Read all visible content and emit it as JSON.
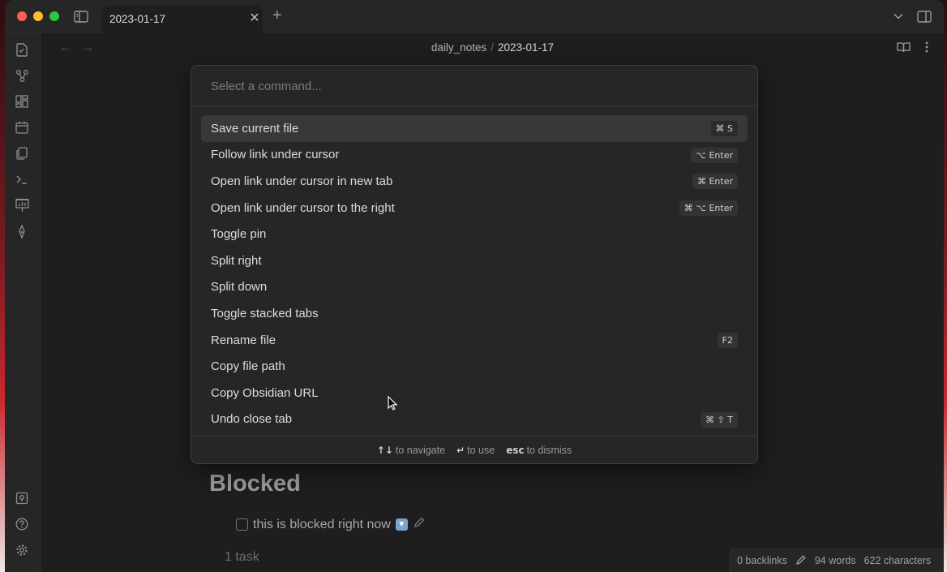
{
  "tab": {
    "title": "2023-01-17",
    "close": "✕",
    "add": "+"
  },
  "breadcrumb": {
    "folder": "daily_notes",
    "separator": "/",
    "file": "2023-01-17"
  },
  "palette": {
    "placeholder": "Select a command...",
    "commands": [
      {
        "label": "Save current file",
        "shortcut": "⌘ S",
        "selected": true
      },
      {
        "label": "Follow link under cursor",
        "shortcut": "⌥ Enter"
      },
      {
        "label": "Open link under cursor in new tab",
        "shortcut": "⌘ Enter"
      },
      {
        "label": "Open link under cursor to the right",
        "shortcut": "⌘ ⌥ Enter"
      },
      {
        "label": "Toggle pin",
        "shortcut": ""
      },
      {
        "label": "Split right",
        "shortcut": ""
      },
      {
        "label": "Split down",
        "shortcut": ""
      },
      {
        "label": "Toggle stacked tabs",
        "shortcut": ""
      },
      {
        "label": "Rename file",
        "shortcut": "F2"
      },
      {
        "label": "Copy file path",
        "shortcut": ""
      },
      {
        "label": "Copy Obsidian URL",
        "shortcut": ""
      },
      {
        "label": "Undo close tab",
        "shortcut": "⌘ ⇧ T"
      }
    ],
    "footer": [
      {
        "key": "↑↓",
        "text": "to navigate"
      },
      {
        "key": "↵",
        "text": "to use"
      },
      {
        "key": "esc",
        "text": "to dismiss"
      }
    ]
  },
  "note": {
    "heading": "Blocked",
    "task": "this is blocked right now",
    "task_emoji": "🔽",
    "task_count": "1 task"
  },
  "status": {
    "backlinks": "0 backlinks",
    "words": "94 words",
    "characters": "622 characters"
  },
  "colors": {
    "background": "#1e1e1e",
    "panel": "#262626",
    "selected": "#383838",
    "accent_red": "#fe5f57",
    "accent_yellow": "#febc2e",
    "accent_green": "#28c840"
  },
  "icons": {
    "ribbon_top": [
      "open-quick-switcher-icon",
      "graph-view-icon",
      "canvas-icon",
      "daily-note-icon",
      "templates-icon",
      "command-palette-icon",
      "slides-icon",
      "excalidraw-icon"
    ],
    "ribbon_bottom": [
      "vault-switch-icon",
      "help-icon",
      "settings-icon"
    ]
  }
}
